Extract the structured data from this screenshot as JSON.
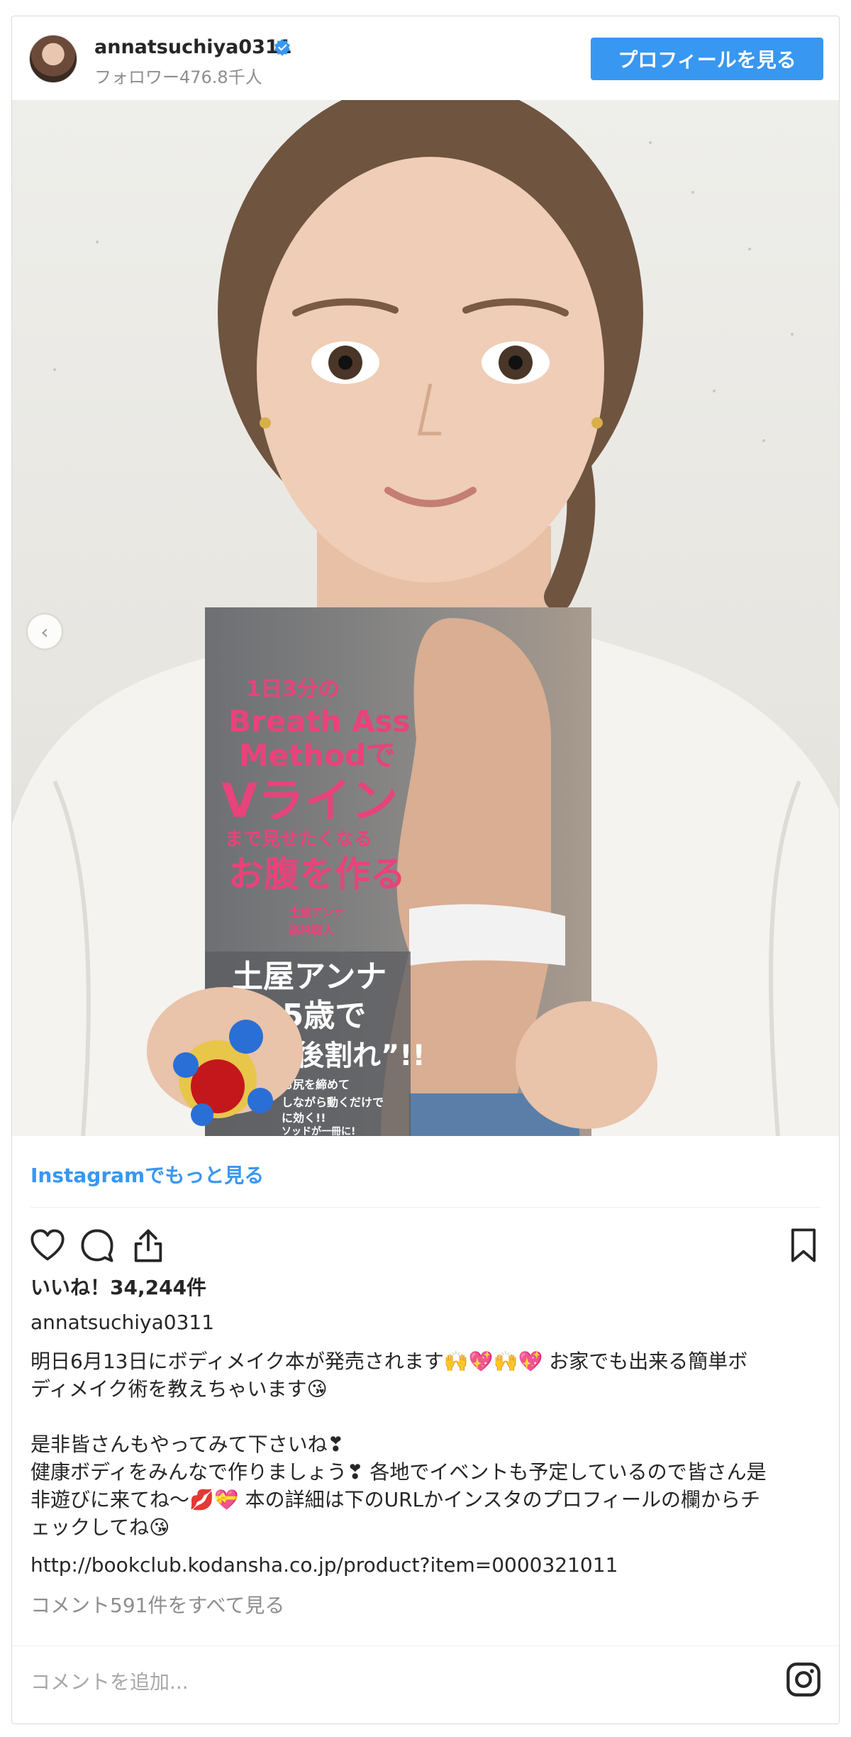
{
  "header": {
    "username": "annatsuchiya0311",
    "followers": "フォロワー476.8千人",
    "profile_button": "プロフィールを見る"
  },
  "post": {
    "more_link": "Instagramでもっと見る",
    "likes": "いいね！34,244件",
    "author": "annatsuchiya0311",
    "caption_lines": [
      "明日6月13日にボディメイク本が発売されます🙌💖🙌💖 お家でも出来る簡単ボ",
      "ディメイク術を教えちゃいます😘",
      "",
      "是非皆さんもやってみて下さいね❣",
      "健康ボディをみんなで作りましょう❣ 各地でイベントも予定しているので皆さん是",
      "非遊びに来てね〜💋💝 本の詳細は下のURLかインスタのプロフィールの欄からチ",
      "ェックしてね😘"
    ],
    "url": "http://bookclub.kodansha.co.jp/product?item=0000321011",
    "view_comments": "コメント591件をすべて見る",
    "comment_placeholder": "コメントを追加..."
  },
  "book": {
    "line1": "1日3分の",
    "line2": "Breath Ass",
    "line3": "Methodで",
    "line4": "Vライン",
    "line5": "まで見せたくなる",
    "line6": "お腹を作る",
    "authors1": "土屋アンナ",
    "authors2": "高林聡人",
    "band1": "土屋アンナ",
    "band2": "35歳で",
    "band3": "産後割れ”!!",
    "band4": "お尻を締めて",
    "band5": "しながら動くだけで",
    "band6": "に効く!!",
    "band7": "ソッドが一冊に!"
  },
  "colors": {
    "accent": "#3897f0",
    "book_pink": "#e8437a"
  }
}
